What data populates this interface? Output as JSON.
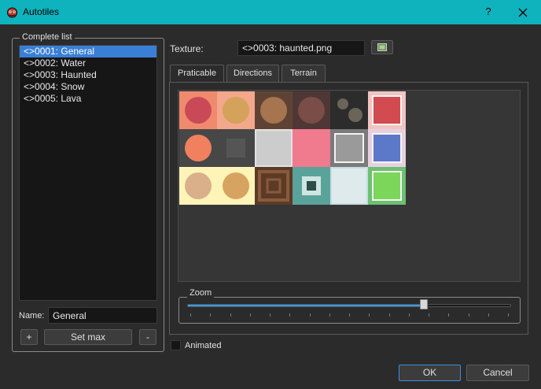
{
  "window": {
    "title": "Autotiles",
    "help_label": "?"
  },
  "complete_list": {
    "title": "Complete list",
    "items": [
      "<>0001: General",
      "<>0002: Water",
      "<>0003: Haunted",
      "<>0004: Snow",
      "<>0005: Lava"
    ],
    "selected_index": 0,
    "name_label": "Name:",
    "name_value": "General",
    "add_label": "+",
    "set_max_label": "Set max",
    "remove_label": "-"
  },
  "texture": {
    "label": "Texture:",
    "value": "<>0003: haunted.png",
    "browse_icon": "folder-image-icon"
  },
  "tabs": [
    {
      "label": "Praticable",
      "active": true
    },
    {
      "label": "Directions",
      "active": false
    },
    {
      "label": "Terrain",
      "active": false
    }
  ],
  "zoom": {
    "title": "Zoom",
    "value": 0.73
  },
  "animated": {
    "label": "Animated",
    "checked": false
  },
  "buttons": {
    "ok": "OK",
    "cancel": "Cancel"
  },
  "colors": {
    "titlebar": "#0fb3be",
    "selection": "#3a7fd6",
    "slider_fill": "#3a9be8",
    "background": "#2b2b2b"
  }
}
